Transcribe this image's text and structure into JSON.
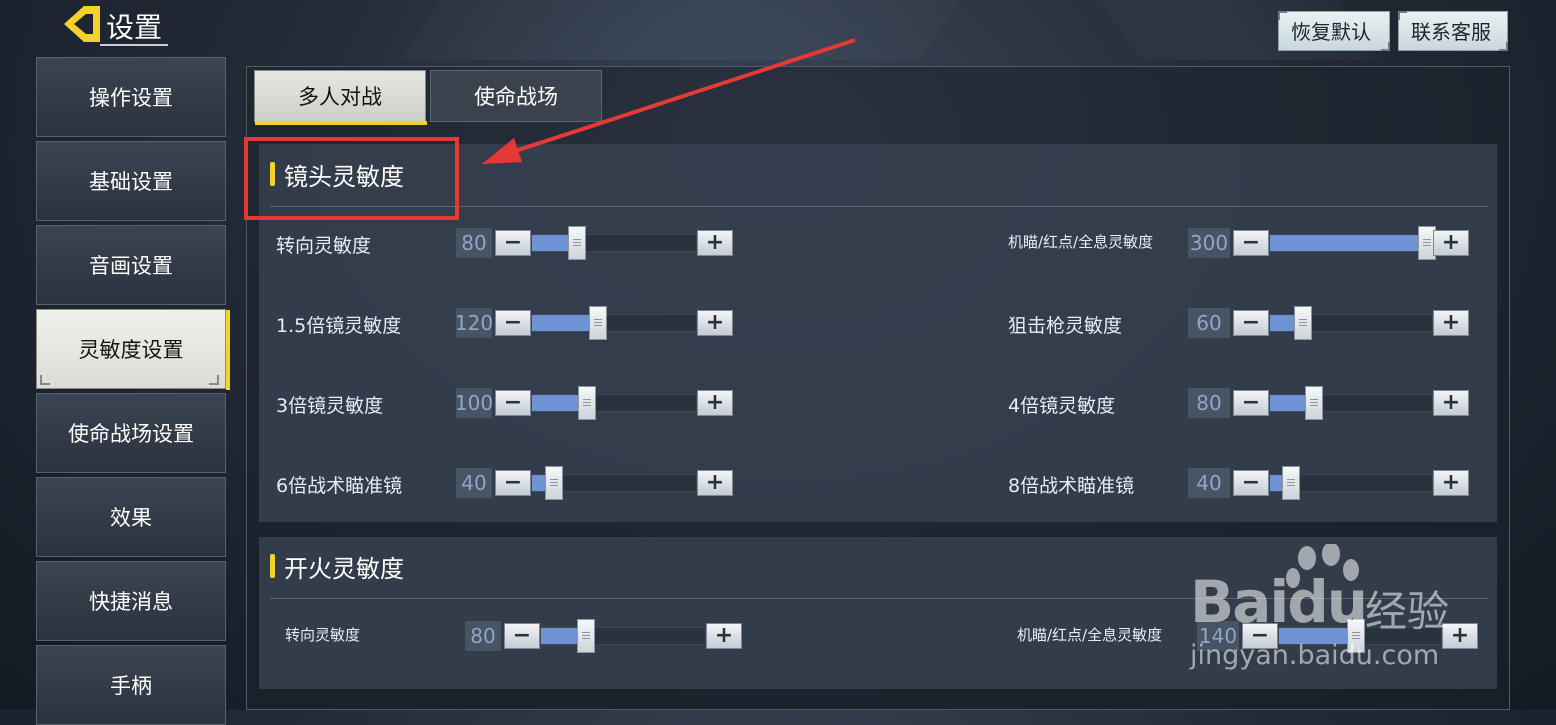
{
  "header": {
    "title": "设置",
    "buttons": {
      "restore_default": "恢复默认",
      "contact_service": "联系客服"
    }
  },
  "sidebar": {
    "items": [
      {
        "label": "操作设置"
      },
      {
        "label": "基础设置"
      },
      {
        "label": "音画设置"
      },
      {
        "label": "灵敏度设置",
        "active": true
      },
      {
        "label": "使命战场设置"
      },
      {
        "label": "效果"
      },
      {
        "label": "快捷消息"
      },
      {
        "label": "手柄"
      }
    ]
  },
  "tabs": [
    {
      "label": "多人对战",
      "active": true
    },
    {
      "label": "使命战场",
      "active": false
    }
  ],
  "sections": {
    "camera": {
      "title": "镜头灵敏度",
      "sliders": [
        {
          "label": "转向灵敏度",
          "value": "80",
          "fraction": 0.27
        },
        {
          "label": "机瞄/红点/全息灵敏度",
          "value": "300",
          "fraction": 0.96
        },
        {
          "label": "1.5倍镜灵敏度",
          "value": "120",
          "fraction": 0.4
        },
        {
          "label": "狙击枪灵敏度",
          "value": "60",
          "fraction": 0.2
        },
        {
          "label": "3倍镜灵敏度",
          "value": "100",
          "fraction": 0.33
        },
        {
          "label": "4倍镜灵敏度",
          "value": "80",
          "fraction": 0.27
        },
        {
          "label": "6倍战术瞄准镜",
          "value": "40",
          "fraction": 0.13
        },
        {
          "label": "8倍战术瞄准镜",
          "value": "40",
          "fraction": 0.13
        }
      ]
    },
    "fire": {
      "title": "开火灵敏度",
      "sliders": [
        {
          "label": "转向灵敏度",
          "value": "80",
          "fraction": 0.27
        },
        {
          "label": "机瞄/红点/全息灵敏度",
          "value": "140",
          "fraction": 0.47
        }
      ]
    }
  },
  "controls": {
    "minus": "−",
    "plus": "+"
  },
  "watermark": {
    "brand_left": "Bai",
    "brand_right": "du",
    "suffix": "经验",
    "url": "jingyan.baidu.com"
  },
  "colors": {
    "accent": "#f3d22c",
    "slider_fill": "#6d93d4",
    "highlight_box": "#e53935"
  }
}
